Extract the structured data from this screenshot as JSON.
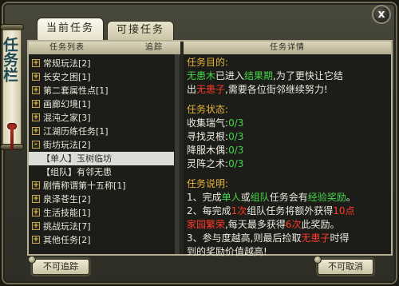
{
  "window": {
    "title": "任务栏",
    "close_label": "x"
  },
  "tabs": [
    {
      "label": "当前任务",
      "active": true
    },
    {
      "label": "可接任务",
      "active": false
    }
  ],
  "list_panel": {
    "header_left": "任务列表",
    "header_right": "追踪",
    "categories": [
      {
        "label": "常规玩法[2]",
        "expander": "+"
      },
      {
        "label": "长安之困[1]",
        "expander": "+"
      },
      {
        "label": "第二套属性点[1]",
        "expander": "+"
      },
      {
        "label": "画廊幻境[1]",
        "expander": "+"
      },
      {
        "label": "混沌之家[3]",
        "expander": "+"
      },
      {
        "label": "江湖历练任务[1]",
        "expander": "+"
      },
      {
        "label": "街坊玩法[2]",
        "expander": "-"
      }
    ],
    "sub_items": [
      {
        "tag": "【单人】",
        "name": "玉树临坊",
        "selected": true
      },
      {
        "tag": "【组队】",
        "name": "有邻无患",
        "selected": false
      }
    ],
    "categories_after": [
      {
        "label": "剧情称谓第十五称[1]",
        "expander": "+"
      },
      {
        "label": "泉泽苍生[2]",
        "expander": "+"
      },
      {
        "label": "生活技能[1]",
        "expander": "+"
      },
      {
        "label": "挑战玩法[7]",
        "expander": "+"
      },
      {
        "label": "其他任务[2]",
        "expander": "+"
      }
    ]
  },
  "detail_panel": {
    "header": "任务详情",
    "goal_heading": "任务目的:",
    "goal_line1_a": "无患木",
    "goal_line1_b": "已进入",
    "goal_line1_c": "结果期",
    "goal_line1_d": ",为了更快让它结",
    "goal_line2_a": "出",
    "goal_line2_b": "无患子",
    "goal_line2_c": ",需要各位街邻继续努力!",
    "status_heading": "任务状态:",
    "status": [
      {
        "name": "收集瑞气",
        "value": "0/3"
      },
      {
        "name": "寻找灵根",
        "value": "0/3"
      },
      {
        "name": "降服木偶",
        "value": "0/3"
      },
      {
        "name": "灵阵之术",
        "value": "0/3"
      }
    ],
    "desc_heading": "任务说明:",
    "desc1_a": "1、完成",
    "desc1_b": "单人",
    "desc1_c": "或",
    "desc1_d": "组队",
    "desc1_e": "任务会有",
    "desc1_f": "经验奖励",
    "desc1_g": "。",
    "desc2_a": "2、每完成",
    "desc2_b": "1次",
    "desc2_c": "组队任务将额外获得",
    "desc2_d": "10点",
    "desc3_a": "家园繁荣",
    "desc3_b": ",每天最多获得",
    "desc3_c": "6次",
    "desc3_d": "此奖励。",
    "desc4_a": "3、参与度越高,则最后捡取",
    "desc4_b": "无患子",
    "desc4_c": "时得",
    "desc5": "到的奖励价值越高!"
  },
  "buttons": {
    "untrack": "不可追踪",
    "cancel": "不可取消"
  },
  "colors": {
    "heading": "#e4b53a",
    "highlight_green": "#45d64a",
    "highlight_red": "#ff3a2a",
    "text": "#ecece0"
  }
}
